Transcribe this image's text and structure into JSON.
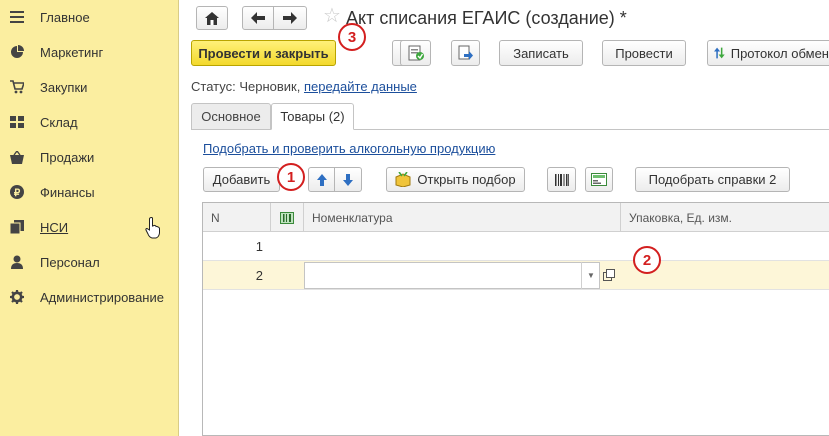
{
  "sidebar": {
    "items": [
      {
        "label": "Главное",
        "icon": "menu-icon"
      },
      {
        "label": "Маркетинг",
        "icon": "pie-chart-icon"
      },
      {
        "label": "Закупки",
        "icon": "cart-icon"
      },
      {
        "label": "Склад",
        "icon": "grid-icon"
      },
      {
        "label": "Продажи",
        "icon": "basket-icon"
      },
      {
        "label": "Финансы",
        "icon": "ruble-icon"
      },
      {
        "label": "НСИ",
        "icon": "books-icon"
      },
      {
        "label": "Персонал",
        "icon": "person-icon"
      },
      {
        "label": "Администрирование",
        "icon": "gear-icon"
      }
    ]
  },
  "header": {
    "title": "Акт списания ЕГАИС (создание) *"
  },
  "toolbar": {
    "post_close": "Провести и закрыть",
    "save": "Записать",
    "post": "Провести",
    "protocol": "Протокол обмен"
  },
  "status": {
    "label": "Статус:",
    "value": "Черновик,",
    "link": "передайте данные"
  },
  "tabs": [
    {
      "label": "Основное",
      "active": false
    },
    {
      "label": "Товары (2)",
      "active": true
    }
  ],
  "goods": {
    "select_link": "Подобрать и проверить алкогольную продукцию",
    "add": "Добавить",
    "open_selection": "Открыть подбор",
    "pick_refs": "Подобрать справки 2",
    "columns": [
      "N",
      "Номенклатура",
      "Упаковка, Ед. изм."
    ],
    "rows": [
      {
        "n": "1",
        "nomenclature": "",
        "package": ""
      },
      {
        "n": "2",
        "nomenclature": "",
        "package": ""
      }
    ]
  },
  "annotations": [
    "1",
    "2",
    "3"
  ],
  "colors": {
    "sidebar_bg": "#fbeea0",
    "primary_button": "#f3d92c",
    "badge_red": "#d31f1f",
    "link_blue": "#1c4f9c",
    "selected_row": "#fdf6d8"
  }
}
